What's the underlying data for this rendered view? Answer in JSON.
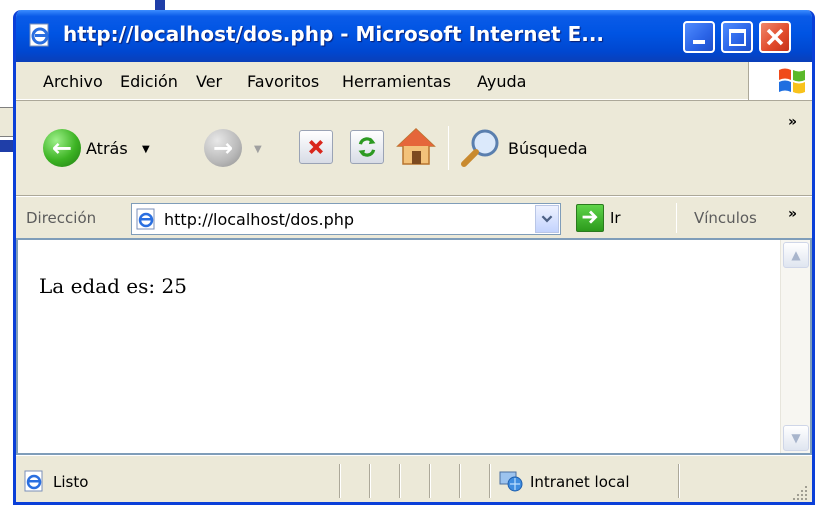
{
  "window": {
    "title": "http://localhost/dos.php - Microsoft Internet E..."
  },
  "menu": [
    "Archivo",
    "Edición",
    "Ver",
    "Favoritos",
    "Herramientas",
    "Ayuda"
  ],
  "toolbar": {
    "back_label": "Atrás",
    "search_label": "Búsqueda"
  },
  "address": {
    "label": "Dirección",
    "url": "http://localhost/dos.php",
    "go_label": "Ir",
    "links_label": "Vínculos"
  },
  "content": {
    "text": "La edad es: 25"
  },
  "status": {
    "text": "Listo",
    "zone": "Intranet local"
  },
  "colors": {
    "title_bar": "#0054e3",
    "window_frame": "#0a3fd8",
    "close_button": "#e0492a",
    "chrome": "#ece9d8"
  },
  "icons": [
    "ie-page-icon",
    "minimize-icon",
    "maximize-icon",
    "close-icon",
    "windows-logo-icon",
    "back-arrow-icon",
    "forward-arrow-icon",
    "stop-icon",
    "refresh-icon",
    "home-icon",
    "search-icon",
    "go-arrow-icon",
    "intranet-globe-icon"
  ]
}
